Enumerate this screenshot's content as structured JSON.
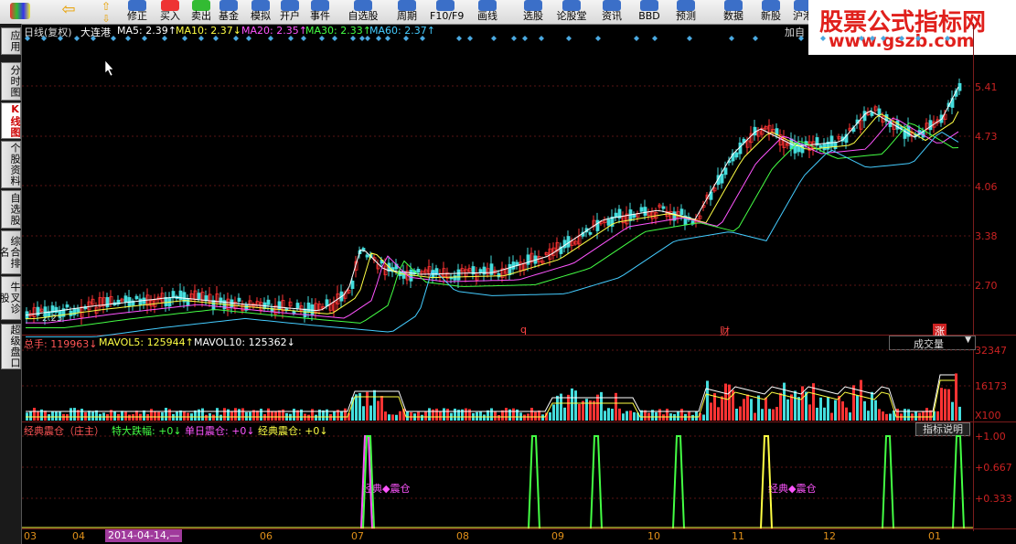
{
  "toolbar": {
    "buttons": [
      {
        "label": "修正",
        "icon": "repair-icon"
      },
      {
        "label": "买入",
        "icon": "buy-icon"
      },
      {
        "label": "卖出",
        "icon": "sell-icon"
      },
      {
        "label": "基金",
        "icon": "fund-icon"
      },
      {
        "label": "模拟",
        "icon": "simulate-icon"
      },
      {
        "label": "开户",
        "icon": "open-account-icon"
      },
      {
        "label": "事件",
        "icon": "hot-event-icon"
      },
      {
        "label": "自选股",
        "icon": "watchlist-icon"
      },
      {
        "label": "周期",
        "icon": "period-icon"
      },
      {
        "label": "F10/F9",
        "icon": "f10-icon"
      },
      {
        "label": "画线",
        "icon": "draw-line-icon"
      },
      {
        "label": "选股",
        "icon": "stock-select-icon"
      },
      {
        "label": "论股堂",
        "icon": "forum-icon"
      },
      {
        "label": "资讯",
        "icon": "news-icon"
      },
      {
        "label": "BBD",
        "icon": "bbd-icon"
      },
      {
        "label": "预测",
        "icon": "forecast-icon"
      },
      {
        "label": "数据",
        "icon": "data-icon"
      },
      {
        "label": "新股",
        "icon": "new-stock-icon"
      },
      {
        "label": "沪港",
        "icon": "hk-connect-icon"
      }
    ]
  },
  "sidebar": {
    "items": [
      {
        "label": "应用"
      },
      {
        "label": "分时图"
      },
      {
        "label": "K线图"
      },
      {
        "label": "个股资料"
      },
      {
        "label": "自选股"
      },
      {
        "label": "综合排名"
      },
      {
        "label": "牛叉诊股"
      },
      {
        "label": "超级盘口"
      }
    ]
  },
  "watermark": {
    "line1": "股票公式指标网",
    "line2": "www.gszb.com"
  },
  "price_panel": {
    "title": "日线(复权)",
    "stock": "大连港",
    "ma5": "MA5: 2.39↑",
    "ma10": "MA10: 2.37↓",
    "ma20": "MA20: 2.35↑",
    "ma30": "MA30: 2.33↑",
    "ma60": "MA60: 2.37↑",
    "add_label": "加自",
    "y_ticks": [
      "5.41",
      "4.73",
      "4.06",
      "3.38",
      "2.70"
    ],
    "low_label": "2.23",
    "event_q": "q",
    "event_cai": "财",
    "event_zhang": "涨"
  },
  "volume_panel": {
    "total": "总手: 119963↓",
    "mavol5": "MAVOL5: 125944↑",
    "mavol10": "MAVOL10: 125362↓",
    "selector": "成交量",
    "y_ticks": [
      "32347",
      "16173",
      "X100"
    ]
  },
  "indicator_panel": {
    "name": "经典震仓（庄主）",
    "a": "特大跌幅: +0↓",
    "b": "单日震仓: +0↓",
    "c": "经典震仓: +0↓",
    "help": "指标说明",
    "y_ticks": [
      "+1.00",
      "+0.667",
      "+0.333"
    ],
    "label1": "经典◆震仓",
    "label2": "经典◆震仓"
  },
  "x_axis": {
    "months": [
      "03",
      "04",
      "06",
      "07",
      "08",
      "09",
      "10",
      "11",
      "12",
      "01"
    ],
    "date_badge": "2014-04-14,—"
  },
  "colors": {
    "up": "#ff3333",
    "down": "#44dddd",
    "ma5": "#ffffff",
    "ma10": "#ffff44",
    "ma20": "#ff55ff",
    "ma30": "#44ff44",
    "ma60": "#44ccff"
  }
}
